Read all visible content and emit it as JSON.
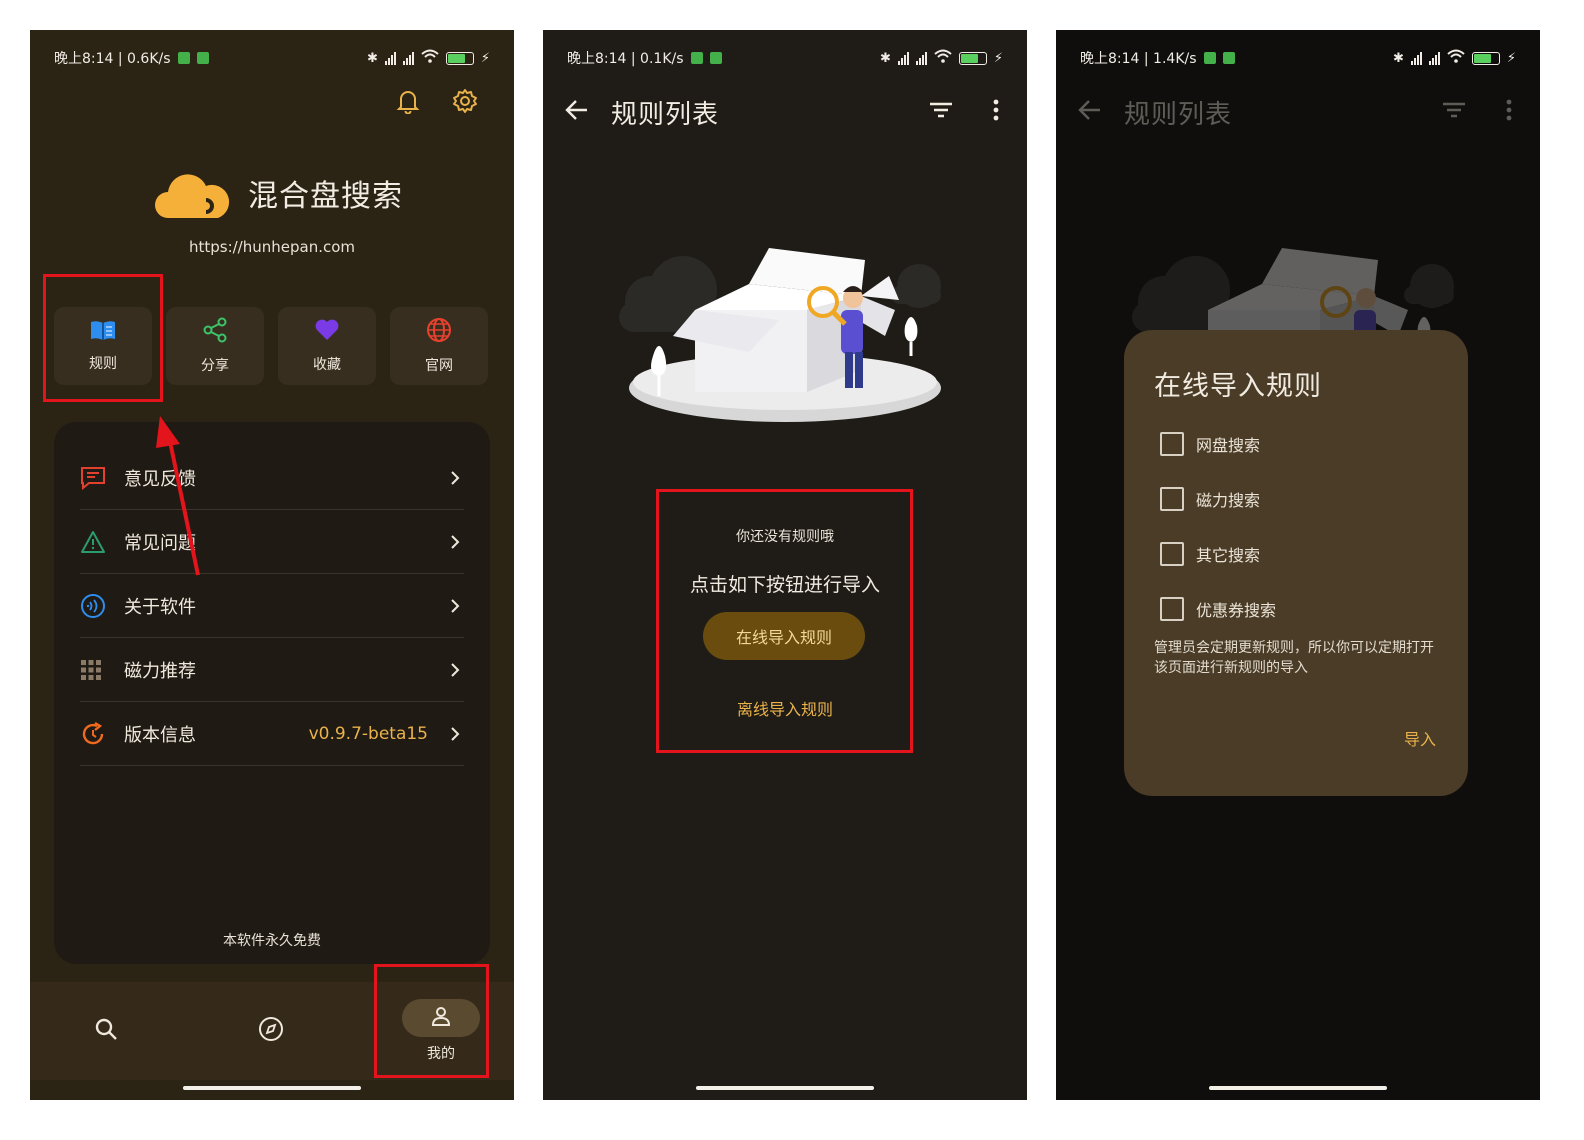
{
  "colors": {
    "accent": "#e9b24b",
    "highlight": "#e3141b",
    "bg1": "#2b2314",
    "bg2": "#1f1c17",
    "dialog": "#4a3c27"
  },
  "panel1": {
    "status": {
      "time": "晚上8:14 | 0.6K/s",
      "battery": "66"
    },
    "app_name": "混合盘搜索",
    "url": "https://hunhepan.com",
    "shortcuts": [
      {
        "label": "规则",
        "icon": "book-icon"
      },
      {
        "label": "分享",
        "icon": "share-icon"
      },
      {
        "label": "收藏",
        "icon": "heart-icon"
      },
      {
        "label": "官网",
        "icon": "globe-icon"
      }
    ],
    "menu": [
      {
        "label": "意见反馈",
        "value": "",
        "icon": "feedback-icon"
      },
      {
        "label": "常见问题",
        "value": "",
        "icon": "warning-icon"
      },
      {
        "label": "关于软件",
        "value": "",
        "icon": "info-icon"
      },
      {
        "label": "磁力推荐",
        "value": "",
        "icon": "grid-icon"
      },
      {
        "label": "版本信息",
        "value": "v0.9.7-beta15",
        "icon": "refresh-icon"
      }
    ],
    "footer": "本软件永久免费",
    "nav": [
      {
        "label": "",
        "icon": "search-icon"
      },
      {
        "label": "",
        "icon": "compass-icon"
      },
      {
        "label": "我的",
        "icon": "person-icon"
      }
    ]
  },
  "panel2": {
    "status": {
      "time": "晚上8:14 | 0.1K/s",
      "battery": "66"
    },
    "title": "规则列表",
    "empty_line1": "你还没有规则哦",
    "empty_line2": "点击如下按钮进行导入",
    "online_button": "在线导入规则",
    "offline_button": "离线导入规则"
  },
  "panel3": {
    "status": {
      "time": "晚上8:14 | 1.4K/s",
      "battery": "66"
    },
    "title": "规则列表",
    "dialog": {
      "title": "在线导入规则",
      "options": [
        "网盘搜索",
        "磁力搜索",
        "其它搜索",
        "优惠券搜索"
      ],
      "note": "管理员会定期更新规则，所以你可以定期打开该页面进行新规则的导入",
      "action": "导入"
    }
  }
}
